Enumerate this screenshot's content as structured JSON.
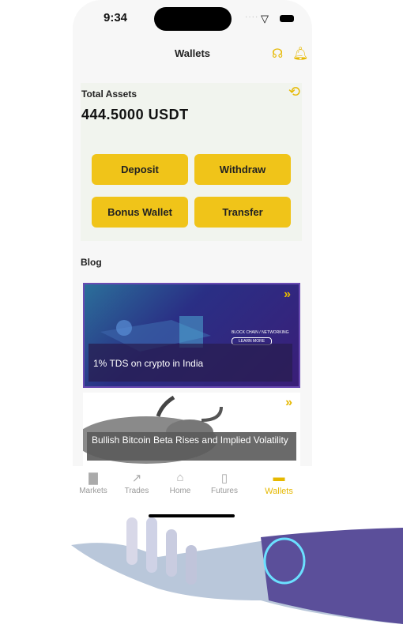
{
  "status": {
    "time": "9:34"
  },
  "header": {
    "title": "Wallets",
    "support_icon": "support-agent-icon",
    "bell_icon": "bell-icon"
  },
  "assets": {
    "label": "Total Assets",
    "amount": "444.5000 USDT",
    "history_icon": "history-icon"
  },
  "actions": {
    "deposit": "Deposit",
    "withdraw": "Withdraw",
    "bonus": "Bonus Wallet",
    "transfer": "Transfer"
  },
  "blog": {
    "heading": "Blog",
    "posts": [
      {
        "title": "1% TDS on crypto in India",
        "banner": "BLOCK CHAIN / NETWORKING",
        "cta": "LEARN MORE"
      },
      {
        "title": "Bullish Bitcoin Beta Rises and Implied Volatility"
      }
    ]
  },
  "tabs": [
    {
      "label": "Markets"
    },
    {
      "label": "Trades"
    },
    {
      "label": "Home"
    },
    {
      "label": "Futures"
    },
    {
      "label": "Wallets",
      "active": true
    }
  ],
  "colors": {
    "accent": "#f0c419",
    "background": "#f7f7f7"
  }
}
